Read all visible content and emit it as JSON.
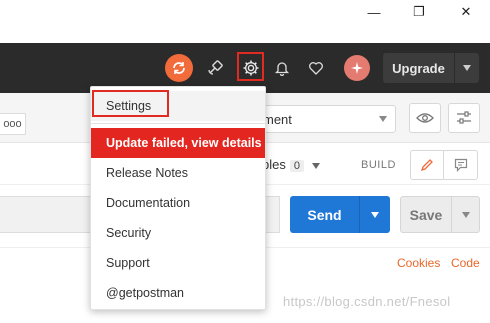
{
  "window": {
    "minimize_glyph": "—",
    "restore_glyph": "❐",
    "close_glyph": "✕"
  },
  "header": {
    "upgrade_label": "Upgrade",
    "icons": [
      "sync-icon",
      "satellite-icon",
      "gear-icon",
      "bell-icon",
      "heart-icon",
      "avatar-icon"
    ],
    "accent_color": "#f26b3a"
  },
  "tabs": {
    "more_label": "ooo"
  },
  "environment": {
    "selected": "ment"
  },
  "request_info": {
    "examples_label": "ples",
    "examples_count": "0",
    "build_label": "BUILD"
  },
  "url_bar": {
    "send_label": "Send",
    "save_label": "Save",
    "send_color": "#1f77d6"
  },
  "links": {
    "cookies": "Cookies",
    "code": "Code"
  },
  "watermark": "https://blog.csdn.net/Fnesol",
  "settings_menu": {
    "items": [
      {
        "label": "Settings"
      },
      {
        "label": "Update failed, view details"
      },
      {
        "label": "Release Notes"
      },
      {
        "label": "Documentation"
      },
      {
        "label": "Security"
      },
      {
        "label": "Support"
      },
      {
        "label": "@getpostman"
      }
    ],
    "highlight_color": "#e3261f"
  }
}
